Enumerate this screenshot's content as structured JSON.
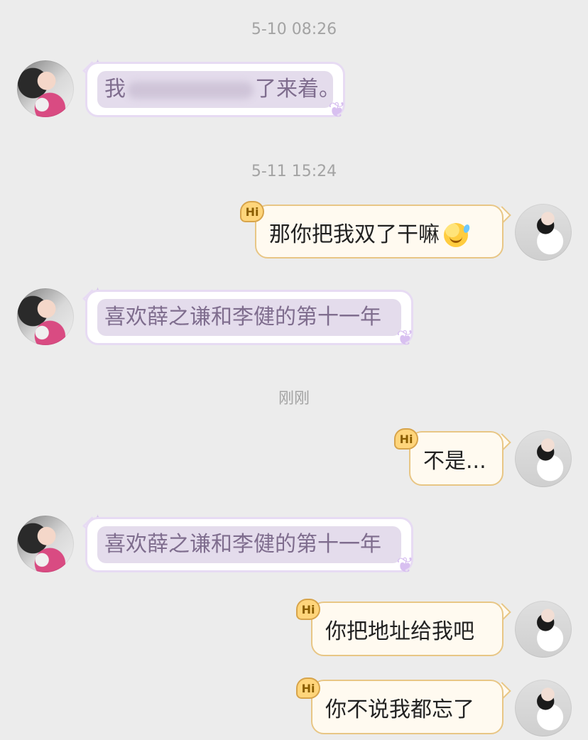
{
  "timestamps": [
    "5-10 08:26",
    "5-11 15:24",
    "刚刚"
  ],
  "messages": [
    {
      "side": "left",
      "text_before": "我",
      "text_after": "了来着。"
    },
    {
      "side": "right",
      "text": "那你把我双了干嘛",
      "emoji": "sweat-smile-emoji"
    },
    {
      "side": "left",
      "text": "喜欢薛之谦和李健的第十一年"
    },
    {
      "side": "right",
      "text": "不是..."
    },
    {
      "side": "left",
      "text": "喜欢薛之谦和李健的第十一年"
    },
    {
      "side": "right",
      "text": "你把地址给我吧"
    },
    {
      "side": "right",
      "text": "你不说我都忘了"
    }
  ],
  "badges": {
    "hi": "Hi"
  },
  "icons": {
    "left_decor": "butterfly-icon",
    "left_corner": "sparkle-icon",
    "emoji": "sweat-smile-emoji"
  },
  "colors": {
    "background": "#ececec",
    "left_bubble_fill": "#e4dcec",
    "left_bubble_border": "#e7dbf3",
    "right_bubble_fill": "#fffaf0",
    "right_bubble_border": "#e8c685",
    "timestamp": "#a3a3a3"
  }
}
